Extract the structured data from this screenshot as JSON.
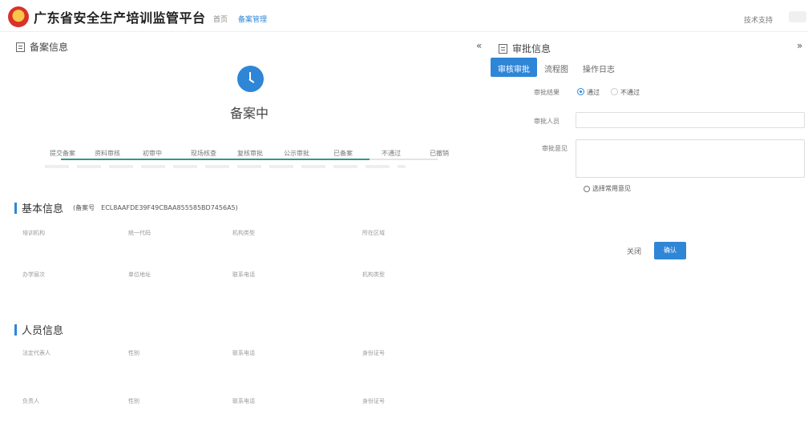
{
  "header": {
    "title": "广东省安全生产培训监管平台",
    "nav": [
      "首页",
      "备案管理"
    ],
    "tech_support": "技术支持"
  },
  "record": {
    "section_title": "备案信息",
    "status_text": "备案中",
    "steps": [
      "提交备案",
      "资料审核",
      "初审中",
      "现场核查",
      "复核审批",
      "公示审批",
      "已备案",
      "不通过",
      "已撤销"
    ],
    "progress_fraction": 0.82
  },
  "basic": {
    "title": "基本信息",
    "record_no_label": "(备案号",
    "record_no": "ECL8AAFDE39F49CBAA855585BD7456A5)",
    "labels": [
      "培训机构",
      "统一代码",
      "机构类型",
      "所在区域",
      "办学层次",
      "单位地址",
      "联系电话",
      "机构类型"
    ]
  },
  "personnel": {
    "title": "人员信息",
    "labels": [
      "法定代表人",
      "性别",
      "联系电话",
      "身份证号",
      "负责人",
      "性别",
      "联系电话",
      "身份证号"
    ]
  },
  "approval": {
    "section_title": "审批信息",
    "tabs": [
      "审核审批",
      "流程图",
      "操作日志"
    ],
    "result_label": "审批结果",
    "pass": "通过",
    "fail": "不通过",
    "approver_label": "审批人员",
    "opinion_label": "审批意见",
    "select_common": "选择常用意见",
    "close": "关闭",
    "confirm": "确认"
  }
}
